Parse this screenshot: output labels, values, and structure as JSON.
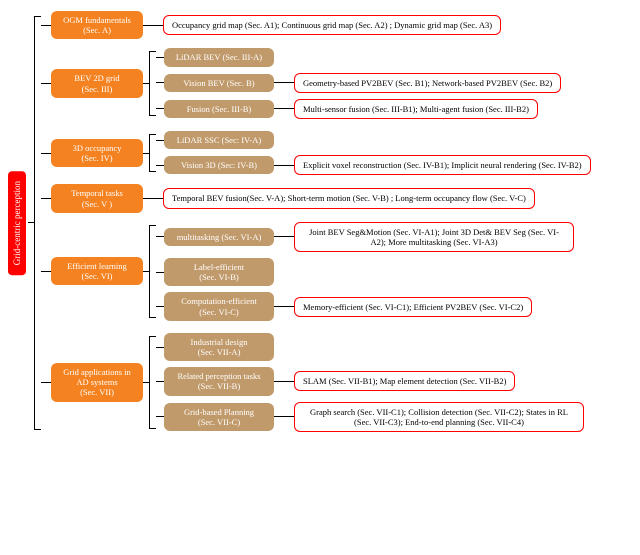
{
  "root": {
    "label": "Grid-centric perception"
  },
  "sections": {
    "ogm": {
      "title": "OGM fundamentals",
      "sec": "A",
      "leaf": "Occupancy grid map (Sec. A1); Continuous grid map (Sec. A2) ; Dynamic grid map (Sec. A3)"
    },
    "bev": {
      "title": "BEV 2D grid",
      "sec": "III",
      "lidar": {
        "title": "LiDAR BEV",
        "sec": "III-A"
      },
      "vision": {
        "title": "Vision BEV",
        "sec": "B",
        "leaf": "Geometry-based PV2BEV (Sec. B1); Network-based PV2BEV (Sec. B2)"
      },
      "fusion": {
        "title": "Fusion",
        "sec": "III-B",
        "leaf": "Multi-sensor fusion (Sec. III-B1); Multi-agent fusion (Sec. III-B2)"
      }
    },
    "occ3d": {
      "title": "3D occupancy",
      "sec": "IV",
      "lidar": {
        "title": "LiDAR SSC",
        "sec": "IV-A"
      },
      "vision": {
        "title": "Vision 3D",
        "sec": "IV-B",
        "leaf": "Explicit voxel reconstruction (Sec. IV-B1); Implicit neural rendering (Sec. IV-B2)"
      }
    },
    "temporal": {
      "title": "Temporal tasks",
      "sec": "V",
      "leaf": "Temporal BEV fusion(Sec. V-A); Short-term motion (Sec. V-B) ; Long-term occupancy flow (Sec. V-C)"
    },
    "eff": {
      "title": "Efficient learning",
      "sec": "VI",
      "multi": {
        "title": "multitasking",
        "sec": "VI-A",
        "leaf": "Joint BEV Seg&Motion (Sec. VI-A1); Joint 3D Det& BEV Seg (Sec. VI-A2); More multitasking (Sec. VI-A3)"
      },
      "label": {
        "title": "Label-efficient",
        "sec": "VI-B"
      },
      "comp": {
        "title": "Computation-efficient",
        "sec": "VI-C",
        "leaf": "Memory-efficient (Sec. VI-C1); Efficient PV2BEV (Sec. VI-C2)"
      }
    },
    "app": {
      "title": "Grid applications in AD systems",
      "sec": "VII",
      "ind": {
        "title": "Industrial design",
        "sec": "VII-A"
      },
      "rel": {
        "title": "Related perception tasks",
        "sec": "VII-B",
        "leaf": "SLAM (Sec. VII-B1); Map element detection (Sec. VII-B2)"
      },
      "plan": {
        "title": "Grid-based Planning",
        "sec": "VII-C",
        "leaf": "Graph search (Sec. VII-C1); Collision detection (Sec. VII-C2); States in RL (Sec. VII-C3); End-to-end planning (Sec. VII-C4)"
      }
    }
  }
}
